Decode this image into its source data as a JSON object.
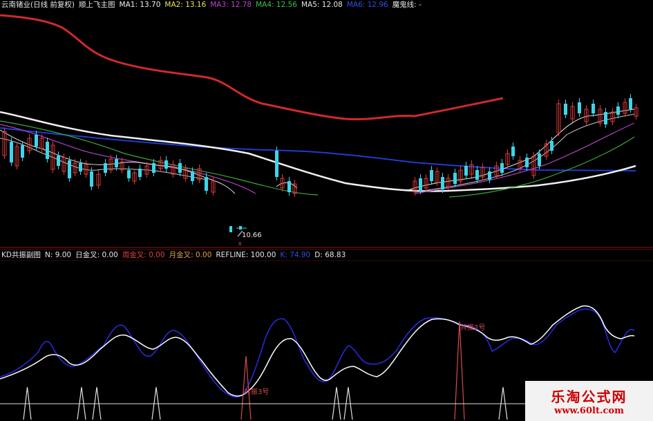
{
  "main_header": {
    "stock": "云南锗业(日线 前复权)",
    "indicator": "顺上飞主图",
    "ma1": "MA1: 13.70",
    "ma2": "MA2: 13.16",
    "ma3": "MA3: 12.78",
    "ma4": "MA4: 12.56",
    "ma5": "MA5: 12.08",
    "ma6": "MA6: 12.96",
    "extra": "魔鬼线: -"
  },
  "sub_header": {
    "name": "KD共振副图",
    "n": "N: 9.00",
    "day_cross": "日金叉: 0.00",
    "week_cross": "周金叉: 0.00",
    "month_cross": "月金叉: 0.00",
    "refline": "REFLINE: 100.00",
    "k": "K: 74.90",
    "d": "D: 68.83"
  },
  "low_label": "10.66",
  "sub_labels": {
    "label1": "共振3号",
    "label2": "共振2号"
  },
  "watermark": {
    "line1": "乐淘公式网",
    "line2": "www.60lt.com"
  },
  "colors": {
    "bg": "#000000",
    "header_text": "#e8e8e8",
    "up_candle": "#d83a3a",
    "down_candle": "#3fd4e8",
    "long_ma": "#d02a2a",
    "blue_line": "#1e3cd2",
    "white_line": "#f0f0f0",
    "k_line": "#ffffff",
    "d_line": "#2a2ae6",
    "magenta_ma": "#b040c0",
    "green_ma": "#3aa83a",
    "signal": "#e0e0e0",
    "signal_red": "#d84c4c",
    "divider": "#8a1414"
  }
}
